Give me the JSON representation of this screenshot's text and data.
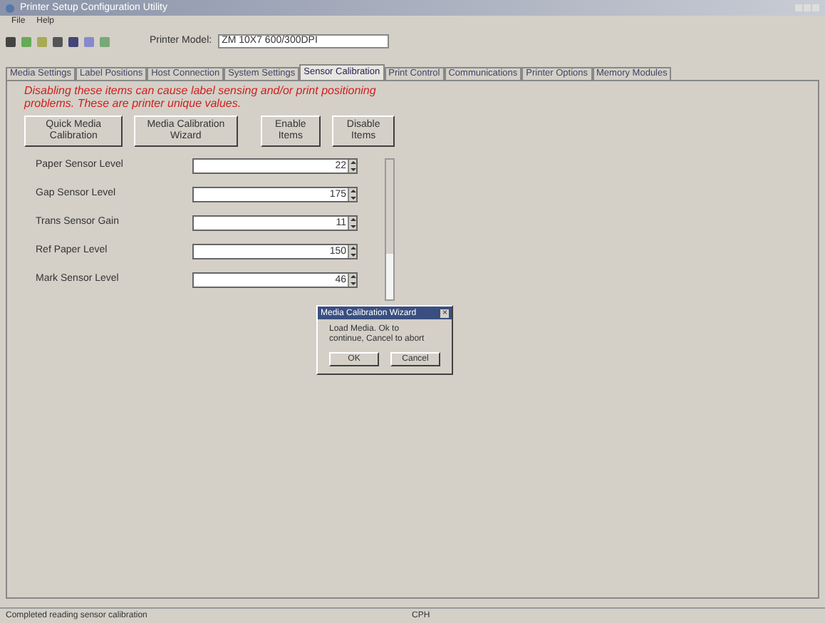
{
  "window": {
    "title": "Printer Setup Configuration Utility"
  },
  "menu": [
    "File",
    "Help"
  ],
  "printer_model": {
    "label": "Printer Model:",
    "value": "ZM 10X7 600/300DPI"
  },
  "tabs": [
    {
      "label": "Media Settings",
      "selected": false
    },
    {
      "label": "Label Positions",
      "selected": false
    },
    {
      "label": "Host Connection",
      "selected": false
    },
    {
      "label": "System Settings",
      "selected": false
    },
    {
      "label": "Sensor Calibration",
      "selected": true
    },
    {
      "label": "Print Control",
      "selected": false
    },
    {
      "label": "Communications",
      "selected": false
    },
    {
      "label": "Printer Options",
      "selected": false
    },
    {
      "label": "Memory Modules",
      "selected": false
    }
  ],
  "warning": "Disabling these items can cause label sensing and/or print positioning problems. These are printer unique values.",
  "buttons_left": [
    "Quick Media Calibration",
    "Media Calibration Wizard"
  ],
  "buttons_right": [
    "Enable Items",
    "Disable Items"
  ],
  "sensors": [
    {
      "label": "Paper Sensor Level",
      "value": "22"
    },
    {
      "label": "Gap Sensor Level",
      "value": "175"
    },
    {
      "label": "Trans Sensor Gain",
      "value": "11"
    },
    {
      "label": "Ref Paper Level",
      "value": "150"
    },
    {
      "label": "Mark Sensor Level",
      "value": "46"
    }
  ],
  "dialog": {
    "title": "Media Calibration Wizard",
    "close": "×",
    "message": "Load Media. Ok to continue, Cancel to abort",
    "buttons": [
      "OK",
      "Cancel"
    ]
  },
  "status_bar": [
    "Completed reading sensor calibration",
    "CPH"
  ]
}
